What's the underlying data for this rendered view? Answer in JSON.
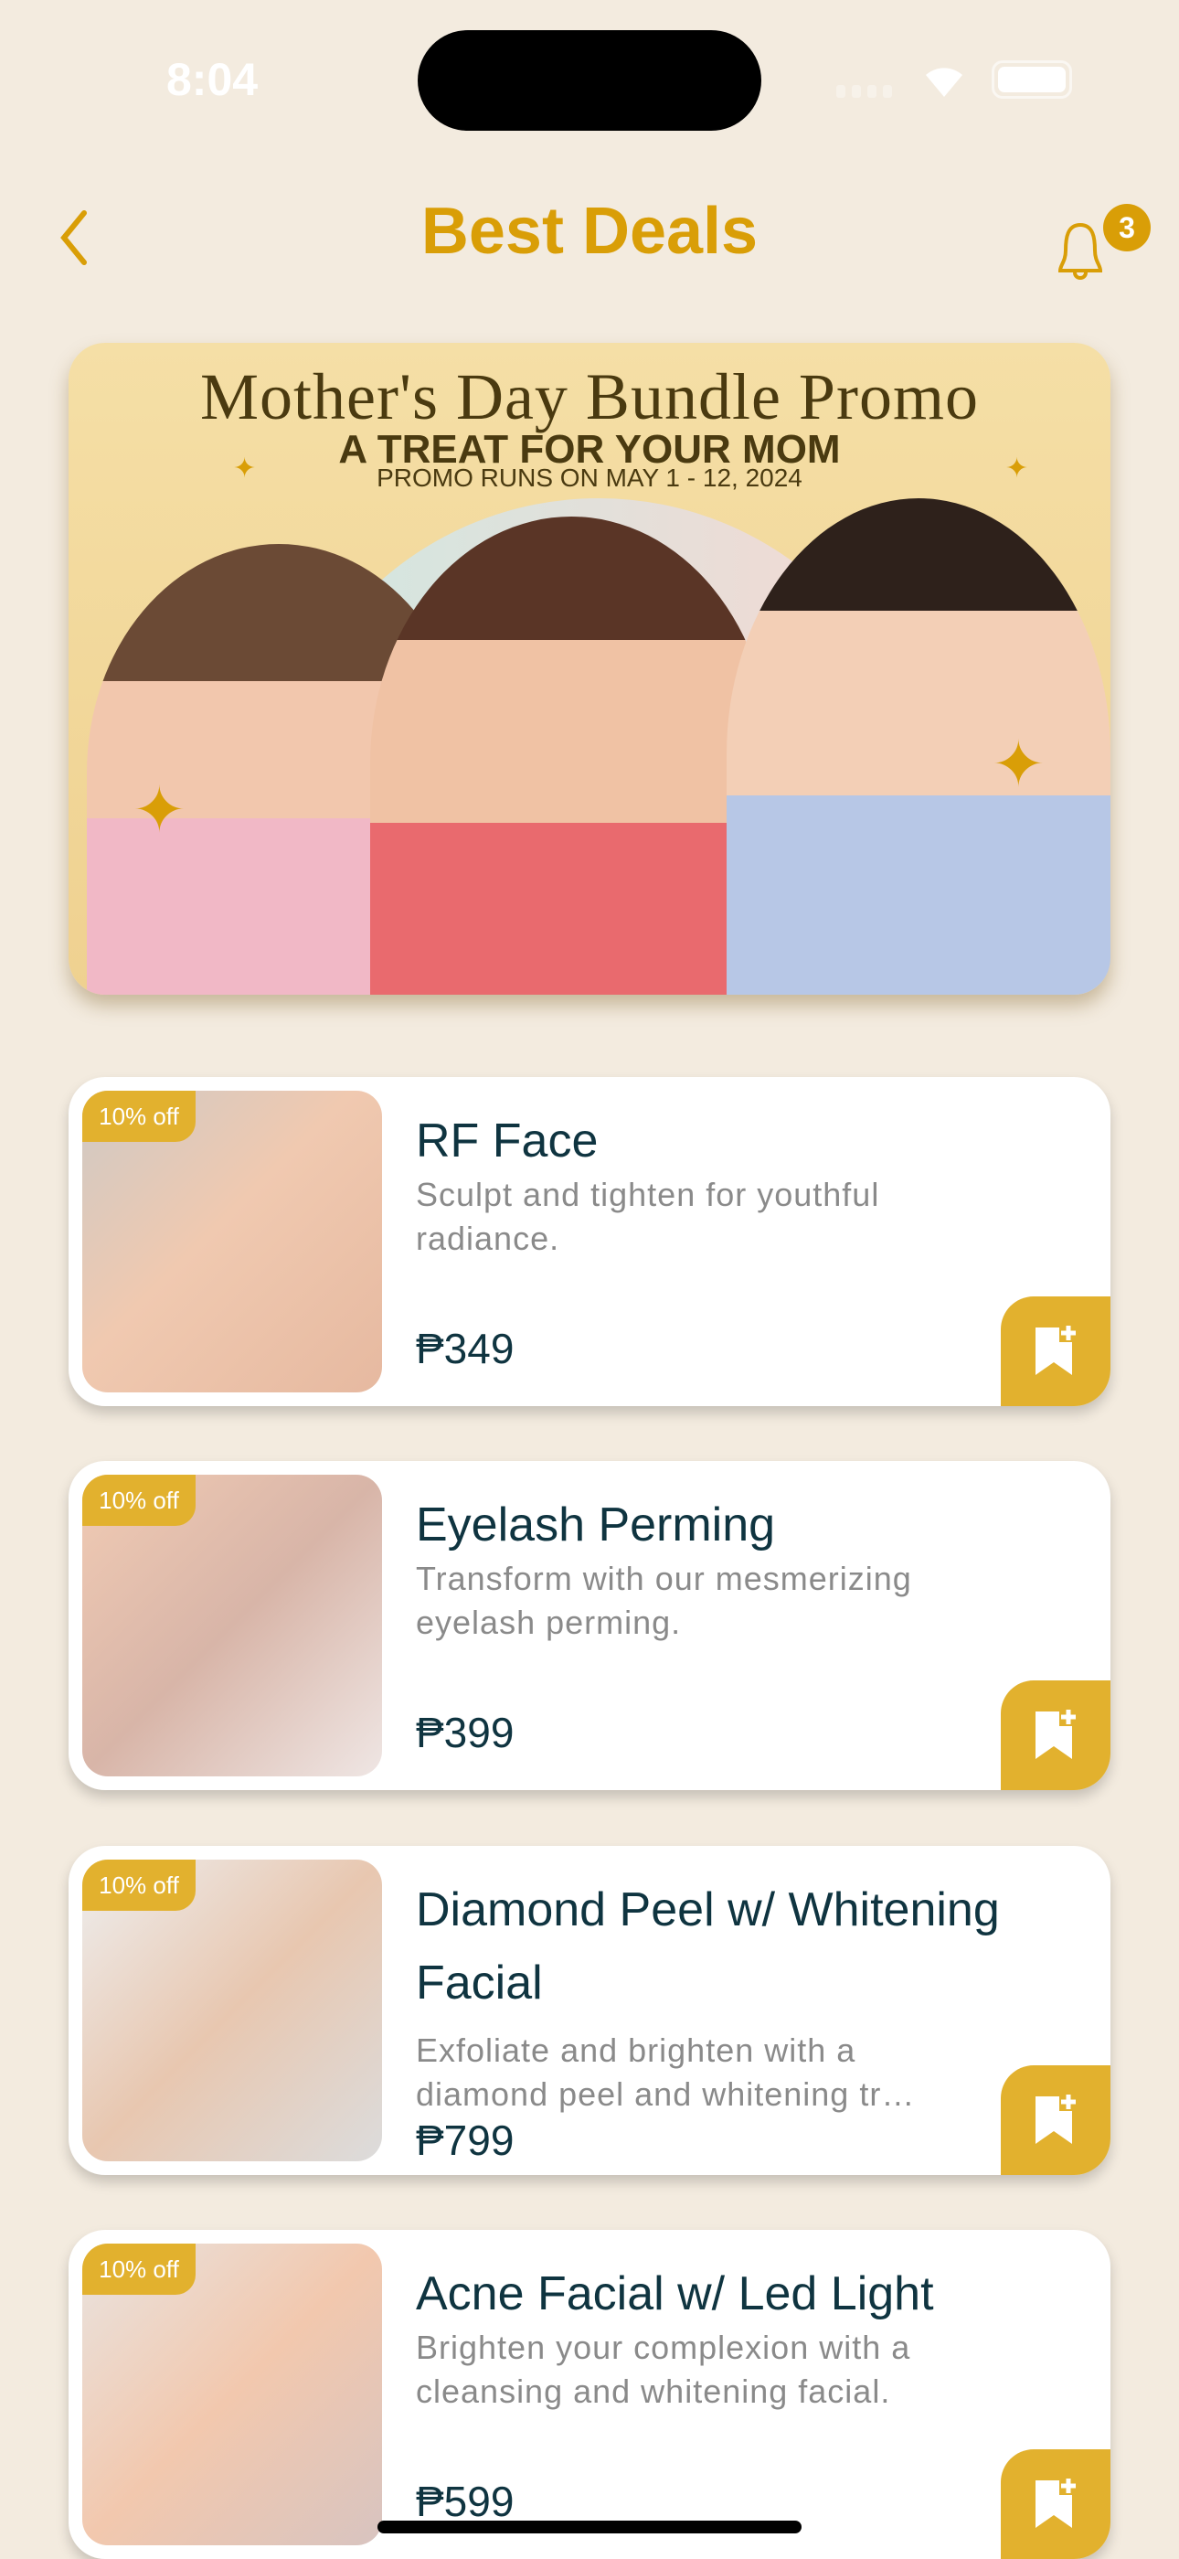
{
  "status_bar": {
    "time": "8:04"
  },
  "header": {
    "title": "Best Deals",
    "notification_count": "3"
  },
  "banner": {
    "title": "Mother's Day Bundle Promo",
    "subtitle": "A TREAT FOR YOUR MOM",
    "dates": "PROMO RUNS ON MAY 1 - 12, 2024"
  },
  "colors": {
    "accent": "#d99e07",
    "badge": "#e2b12e",
    "text_dark": "#0f3440",
    "background": "#f3ebdf"
  },
  "deals": [
    {
      "discount": "10% off",
      "name": "RF Face",
      "description": "Sculpt and tighten for youthful radiance.",
      "price": "₱349"
    },
    {
      "discount": "10% off",
      "name": "Eyelash Perming",
      "description": "Transform with our mesmerizing eyelash perming.",
      "price": "₱399"
    },
    {
      "discount": "10% off",
      "name": "Diamond Peel w/ Whitening Facial",
      "description": "Exfoliate and brighten with a diamond peel and whitening tr…",
      "price": "₱799"
    },
    {
      "discount": "10% off",
      "name": "Acne Facial w/ Led Light",
      "description": "Brighten your complexion with a cleansing and whitening facial.",
      "price": "₱599"
    }
  ]
}
